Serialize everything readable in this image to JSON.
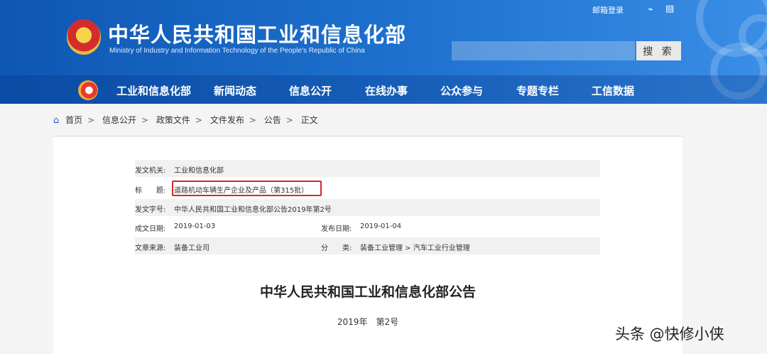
{
  "header": {
    "title": "中华人民共和国工业和信息化部",
    "subtitle": "Ministry of Industry and Information Technology of the People's Republic of China",
    "mail_login": "邮箱登录",
    "search_placeholder": "",
    "search_button": "搜 索"
  },
  "nav": {
    "items": [
      "工业和信息化部",
      "新闻动态",
      "信息公开",
      "在线办事",
      "公众参与",
      "专题专栏",
      "工信数据"
    ]
  },
  "breadcrumb": [
    "首页",
    "信息公开",
    "政策文件",
    "文件发布",
    "公告",
    "正文"
  ],
  "meta": {
    "issuer_label": "发文机关:",
    "issuer": "工业和信息化部",
    "title_label": "标　　题:",
    "title": "道路机动车辆生产企业及产品（第315批）",
    "doc_no_label": "发文字号:",
    "doc_no": "中华人民共和国工业和信息化部公告2019年第2号",
    "created_label": "成文日期:",
    "created": "2019-01-03",
    "published_label": "发布日期:",
    "published": "2019-01-04",
    "source_label": "文章来源:",
    "source": "装备工业司",
    "category_label": "分　　类:",
    "category": "装备工业管理 > 汽车工业行业管理"
  },
  "document": {
    "heading": "中华人民共和国工业和信息化部公告",
    "number": "2019年　第2号"
  },
  "watermark": "头条 @快修小侠",
  "colors": {
    "header": "#1f6ecc",
    "highlight": "#d9262b"
  },
  "icons": [
    "rss-icon",
    "document-icon",
    "home-icon"
  ]
}
